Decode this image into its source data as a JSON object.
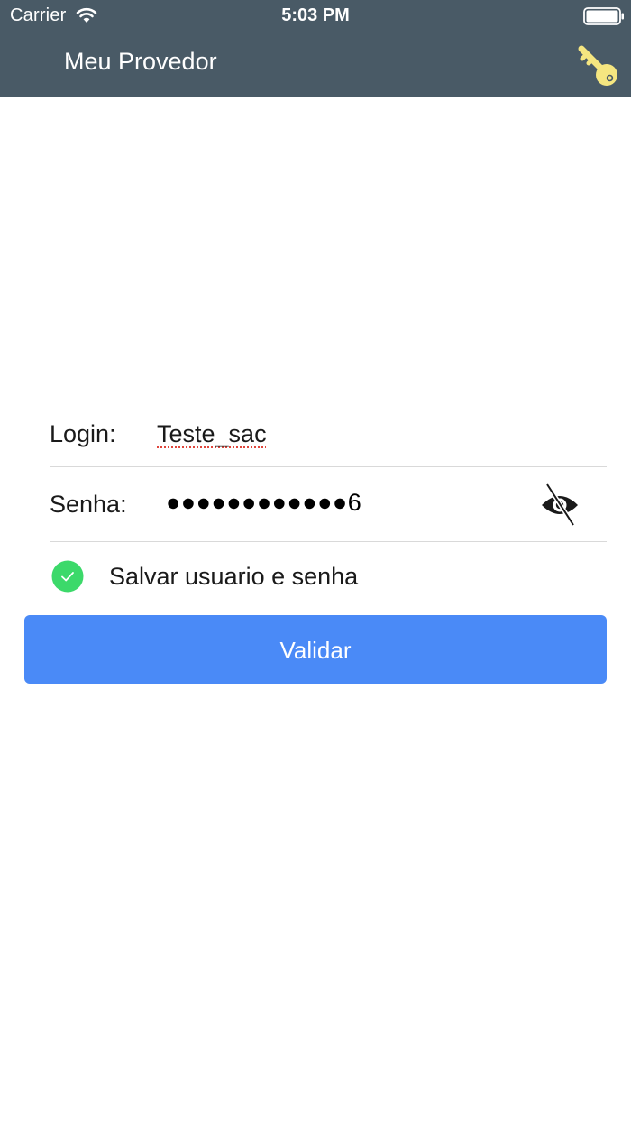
{
  "status_bar": {
    "carrier": "Carrier",
    "time": "5:03 PM",
    "wifi_icon": "wifi-icon",
    "battery_icon": "battery-full-icon"
  },
  "header": {
    "title": "Meu Provedor",
    "background_color": "#495a66",
    "key_icon": "key-icon",
    "key_icon_color": "#f5e680"
  },
  "form": {
    "login_label": "Login:",
    "login_value": "Teste_sac",
    "password_label": "Senha:",
    "password_value": "●●●●●●●●●●●●6",
    "password_toggle_icon": "eye-slash-icon",
    "save_checked": true,
    "save_check_color": "#3cd96a",
    "save_label": "Salvar usuario e senha"
  },
  "actions": {
    "validate_label": "Validar",
    "validate_color": "#4a8af7"
  }
}
